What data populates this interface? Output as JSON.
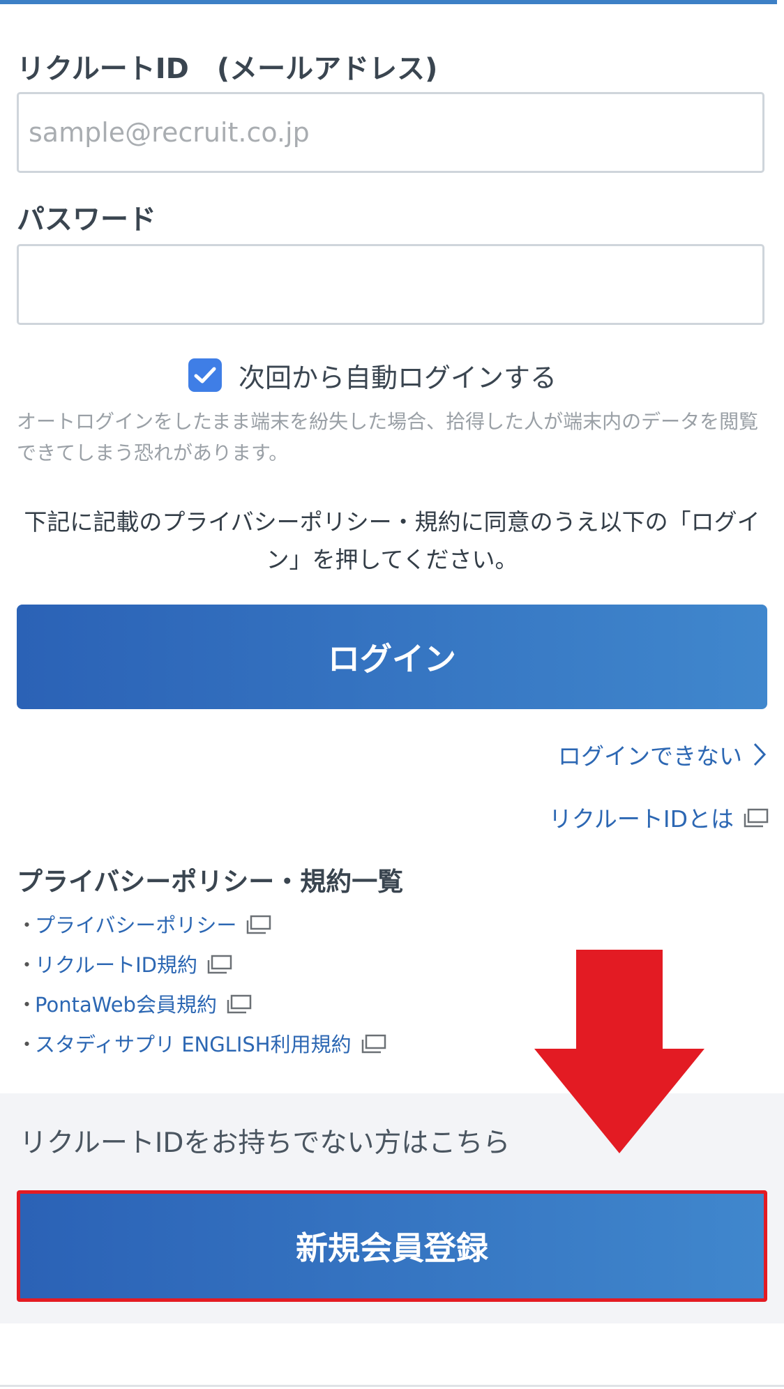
{
  "colors": {
    "accent": "#3d80c6",
    "button_gradient_start": "#2b62b6",
    "button_gradient_end": "#4087cd",
    "link": "#2c67b3",
    "checkbox": "#3f7ee6",
    "highlight_red": "#e31b23",
    "panel_bg": "#f3f4f7"
  },
  "form": {
    "id_label": "リクルートID　(メールアドレス)",
    "id_placeholder": "sample@recruit.co.jp",
    "id_value": "",
    "password_label": "パスワード",
    "password_value": "",
    "auto_login_label": "次回から自動ログインする",
    "auto_login_checked": true,
    "auto_login_warning": "オートログインをしたまま端末を紛失した場合、拾得した人が端末内のデータを閲覧できてしまう恐れがあります。",
    "agreement_text": "下記に記載のプライバシーポリシー・規約に同意のうえ以下の「ログイン」を押してください。",
    "login_button": "ログイン"
  },
  "links": {
    "cannot_login": "ログインできない",
    "about_recruit_id": "リクルートIDとは"
  },
  "policies": {
    "title": "プライバシーポリシー・規約一覧",
    "bullet": "・",
    "items": [
      "プライバシーポリシー",
      "リクルートID規約",
      "PontaWeb会員規約",
      "スタディサプリ ENGLISH利用規約"
    ]
  },
  "signup": {
    "prompt": "リクルートIDをお持ちでない方はこちら",
    "button": "新規会員登録"
  }
}
